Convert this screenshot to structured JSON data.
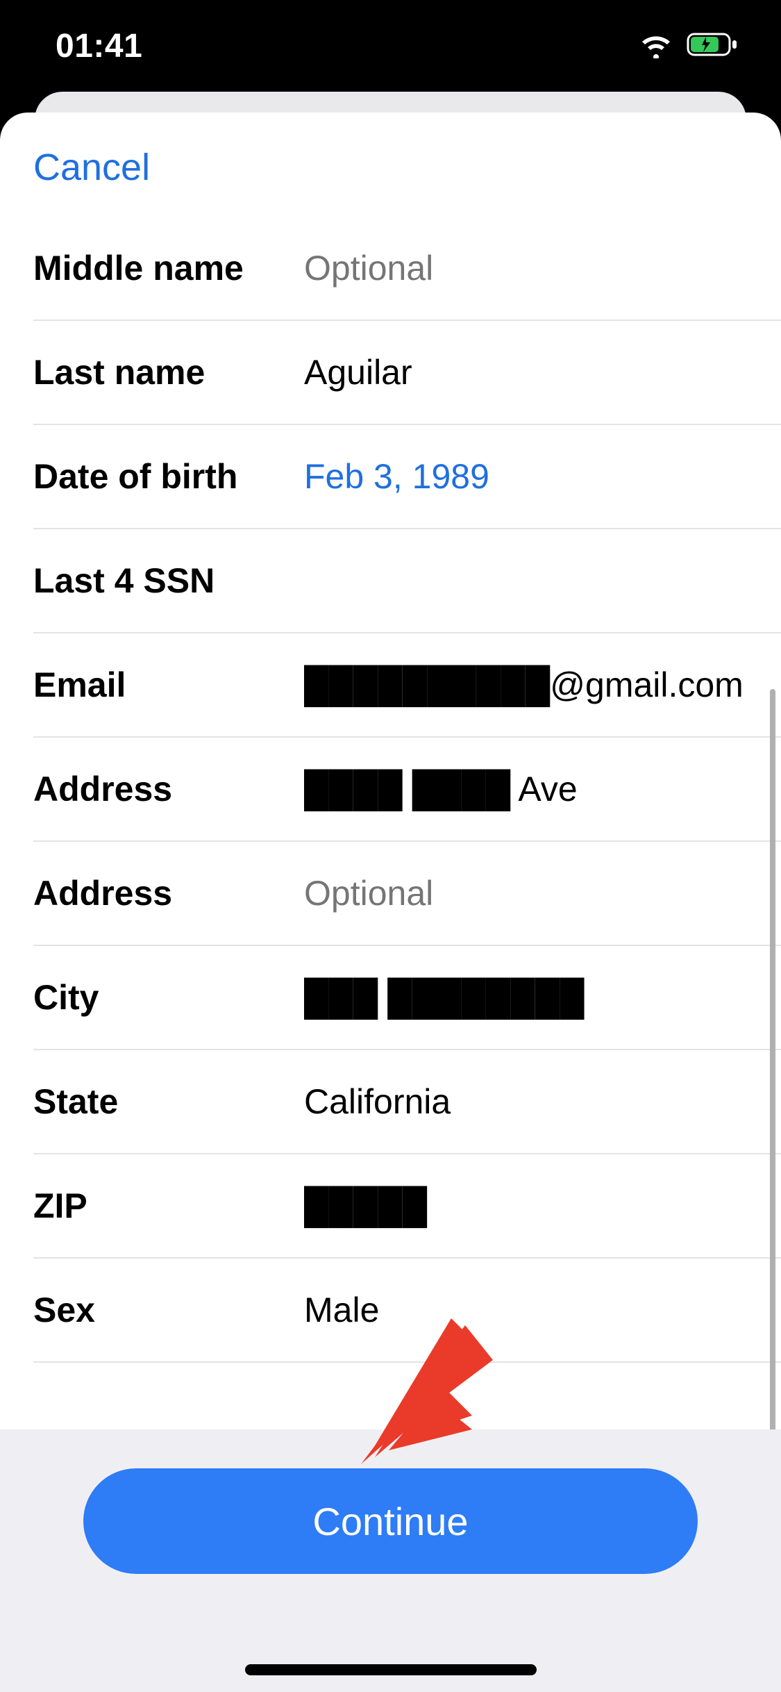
{
  "status": {
    "time": "01:41"
  },
  "modal": {
    "cancel_label": "Cancel",
    "continue_label": "Continue",
    "fields": {
      "middle_name": {
        "label": "Middle name",
        "value": "",
        "placeholder": "Optional"
      },
      "last_name": {
        "label": "Last name",
        "value": "Aguilar"
      },
      "dob": {
        "label": "Date of birth",
        "value": "Feb 3, 1989"
      },
      "ssn4": {
        "label": "Last 4 SSN",
        "value": ""
      },
      "email": {
        "label": "Email",
        "value": "██████████@gmail.com"
      },
      "address1": {
        "label": "Address",
        "value": "████ ████ Ave"
      },
      "address2": {
        "label": "Address",
        "value": "",
        "placeholder": "Optional"
      },
      "city": {
        "label": "City",
        "value": "███ ████████"
      },
      "state": {
        "label": "State",
        "value": "California"
      },
      "zip": {
        "label": "ZIP",
        "value": "█████"
      },
      "sex": {
        "label": "Sex",
        "value": "Male"
      }
    }
  }
}
